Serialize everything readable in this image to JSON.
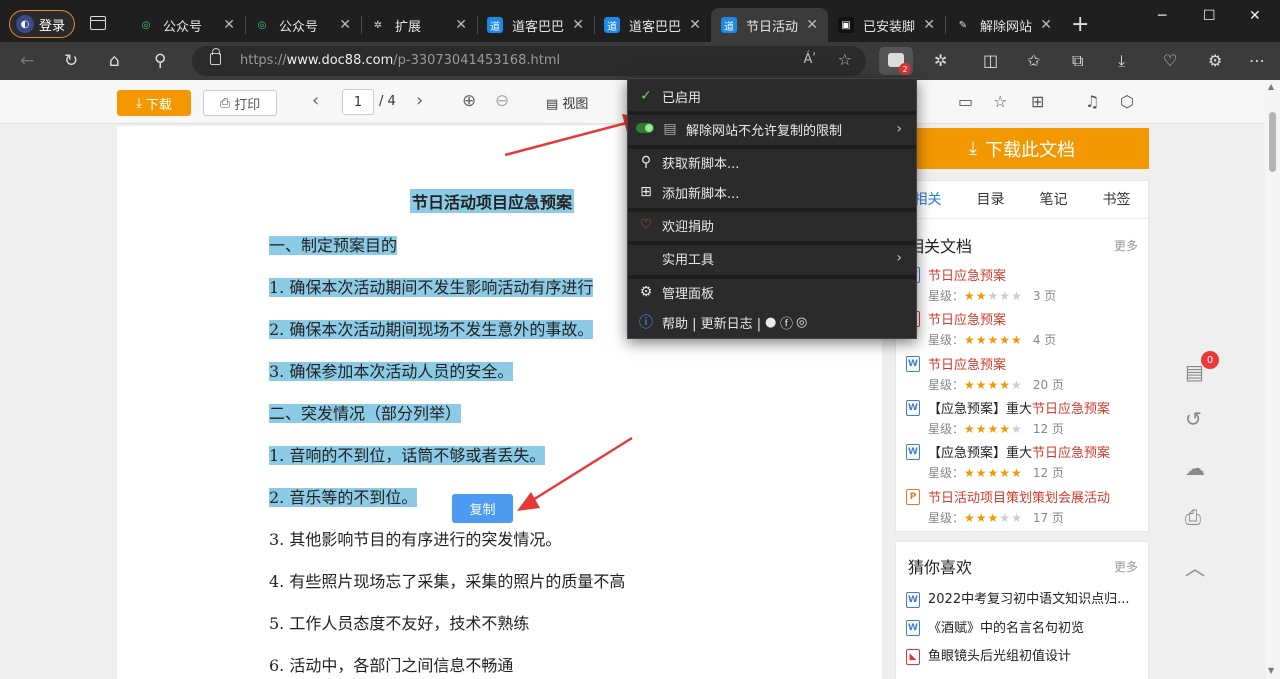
{
  "browser": {
    "login_label": "登录",
    "tabs": [
      {
        "label": "公众号",
        "favicon": "green-ring-icon",
        "active": false
      },
      {
        "label": "公众号",
        "favicon": "green-ring-icon",
        "active": false
      },
      {
        "label": "扩展",
        "favicon": "puzzle-icon",
        "active": false
      },
      {
        "label": "道客巴巴",
        "favicon": "doc88-icon",
        "active": false
      },
      {
        "label": "道客巴巴",
        "favicon": "doc88-icon",
        "active": false
      },
      {
        "label": "节日活动",
        "favicon": "doc88-icon",
        "active": true
      },
      {
        "label": "已安装脚",
        "favicon": "tampermonkey-icon",
        "active": false
      },
      {
        "label": "解除网站",
        "favicon": "script-icon",
        "active": false
      }
    ],
    "url_prefix": "https://",
    "url_host": "www.doc88.com",
    "url_path": "/p-33073041453168.html",
    "read_aloud_label": "Áʹ",
    "extension_badge": "2"
  },
  "doc_toolbar": {
    "download_label": "下载",
    "print_label": "打印",
    "page_current": "1",
    "page_total": "/ 4",
    "view_label": "视图"
  },
  "document": {
    "title": "节日活动项目应急预案",
    "lines": [
      {
        "text": "一、制定预案目的",
        "highlighted": true
      },
      {
        "text": "1. 确保本次活动期间不发生影响活动有序进行",
        "highlighted": true
      },
      {
        "text": "2. 确保本次活动期间现场不发生意外的事故。",
        "highlighted": true
      },
      {
        "text": "3. 确保参加本次活动人员的安全。",
        "highlighted": true
      },
      {
        "text": "二、突发情况（部分列举）",
        "highlighted": true
      },
      {
        "text": "1. 音响的不到位，话筒不够或者丢失。",
        "highlighted": true
      },
      {
        "text": "2. 音乐等的不到位。",
        "highlighted": true
      },
      {
        "text": "3. 其他影响节目的有序进行的突发情况。",
        "highlighted": false
      },
      {
        "text": "4. 有些照片现场忘了采集，采集的照片的质量不高",
        "highlighted": false
      },
      {
        "text": "5. 工作人员态度不友好，技术不熟练",
        "highlighted": false
      },
      {
        "text": "6. 活动中，各部门之间信息不畅通",
        "highlighted": false
      }
    ],
    "copy_button_label": "复制"
  },
  "sidebar": {
    "download_doc_label": "下载此文档",
    "tabs": [
      "相关",
      "目录",
      "笔记",
      "书签"
    ],
    "related_title": "相关文档",
    "more_label": "更多",
    "rating_label": "星级：",
    "related": [
      {
        "title": "节日应急预案",
        "prefix": "",
        "icon": "W",
        "stars": 2,
        "pages": "3 页"
      },
      {
        "title": "节日应急预案",
        "prefix": "",
        "icon": "pdf",
        "stars": 5,
        "pages": "4 页"
      },
      {
        "title": "节日应急预案",
        "prefix": "",
        "icon": "W",
        "stars": 4,
        "pages": "20 页"
      },
      {
        "title": "节日应急预案",
        "prefix": "【应急预案】重大",
        "icon": "W",
        "stars": 4,
        "pages": "12 页"
      },
      {
        "title": "节日应急预案",
        "prefix": "【应急预案】重大",
        "icon": "W",
        "stars": 5,
        "pages": "12 页"
      },
      {
        "title": "活动",
        "prefix": "节日活动项目策划策划会展",
        "icon": "ppt",
        "stars": 3,
        "pages": "17 页"
      }
    ],
    "guess_title": "猜你喜欢",
    "guess": [
      {
        "text": "2022中考复习初中语文知识点归...",
        "icon": "W"
      },
      {
        "text": "《酒赋》中的名言名句初览",
        "icon": "W"
      },
      {
        "text": "鱼眼镜头后光组初值设计",
        "icon": "pdf"
      }
    ],
    "float_badge": "0"
  },
  "ext_menu": {
    "enabled_label": "已启用",
    "script_label": "解除网站不允许复制的限制",
    "get_scripts_label": "获取新脚本...",
    "add_script_label": "添加新脚本...",
    "donate_label": "欢迎捐助",
    "tools_label": "实用工具",
    "dashboard_label": "管理面板",
    "help_label": "帮助 | 更新日志 |"
  },
  "colors": {
    "accent_orange": "#f39800",
    "highlight_blue": "#8ccbe6",
    "link_red": "#d23b2b",
    "copy_blue": "#4b9bf0"
  }
}
